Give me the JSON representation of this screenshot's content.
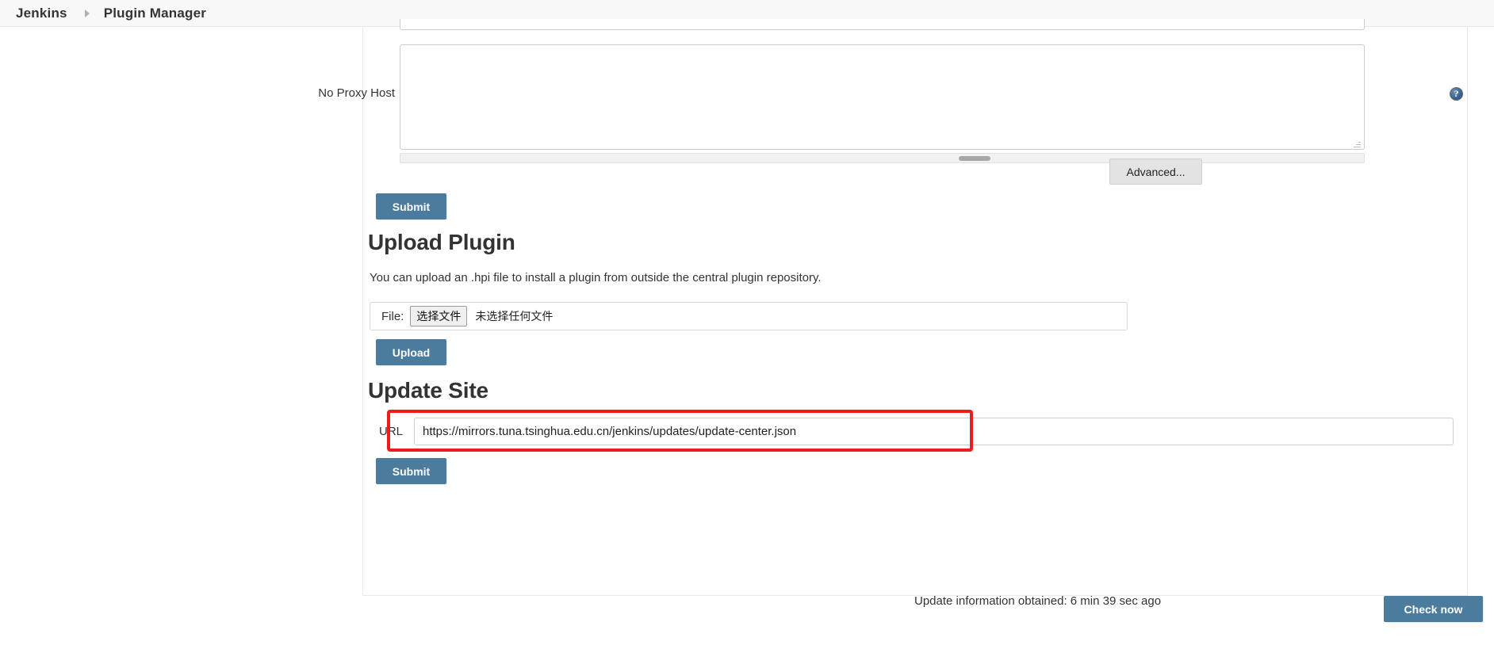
{
  "breadcrumb": {
    "items": [
      {
        "label": "Jenkins",
        "name": "breadcrumb-jenkins"
      },
      {
        "label": "Plugin Manager",
        "name": "breadcrumb-plugin-manager"
      }
    ],
    "separator_icon": "chevron-right-icon"
  },
  "proxy_section": {
    "no_proxy_host_label": "No Proxy Host",
    "no_proxy_host_value": "",
    "no_proxy_host_placeholder": "",
    "help_icon": "help-circle-icon",
    "advanced_label": "Advanced...",
    "submit_label": "Submit"
  },
  "upload_section": {
    "title": "Upload Plugin",
    "description": "You can upload an .hpi file to install a plugin from outside the central plugin repository.",
    "file_label": "File:",
    "choose_file_button": "选择文件",
    "file_status": "未选择任何文件",
    "upload_label": "Upload"
  },
  "update_site_section": {
    "title": "Update Site",
    "url_label": "URL",
    "url_value": "https://mirrors.tuna.tsinghua.edu.cn/jenkins/updates/update-center.json",
    "url_placeholder": "",
    "submit_label": "Submit",
    "highlight_color": "#ef1b1b"
  },
  "footer": {
    "update_info": "Update information obtained: 6 min 39 sec ago",
    "check_now_label": "Check now"
  },
  "colors": {
    "primary_button": "#4b7b9d",
    "gray_button": "#e3e3e3",
    "breadcrumb_bar": "#f8f8f8",
    "text": "#333333",
    "highlight": "#ef1b1b"
  }
}
